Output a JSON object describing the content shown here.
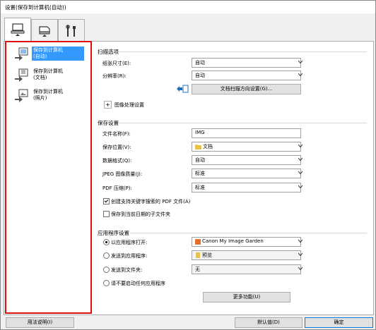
{
  "window": {
    "title": "设置(保存到计算机(自动))"
  },
  "tabs": [
    {
      "name": "scan-from-computer",
      "icon": "computer-scan-icon"
    },
    {
      "name": "scan-from-operation-panel",
      "icon": "scanner-icon"
    },
    {
      "name": "general-settings",
      "icon": "tools-icon"
    }
  ],
  "sidebar": {
    "items": [
      {
        "label1": "保存到计算机",
        "label2": "(自动)",
        "selected": true
      },
      {
        "label1": "保存到计算机",
        "label2": "(文档)",
        "selected": false
      },
      {
        "label1": "保存到计算机",
        "label2": "(照片)",
        "selected": false
      }
    ]
  },
  "scan_options": {
    "title": "扫描选项",
    "paper_size_label": "纸张尺寸(E):",
    "paper_size_value": "自动",
    "resolution_label": "分辨率(R):",
    "resolution_value": "自动",
    "orientation_button": "文档扫描方向设置(G)...",
    "image_processing_label": "图像处理设置"
  },
  "save_settings": {
    "title": "保存设置",
    "file_name_label": "文件名称(F):",
    "file_name_value": "IMG",
    "save_in_label": "保存位置(V):",
    "save_in_value": "文档",
    "data_format_label": "数据格式(Q):",
    "data_format_value": "自动",
    "jpeg_quality_label": "JPEG 图像质量(J):",
    "jpeg_quality_value": "标准",
    "pdf_compression_label": "PDF 压缩(P):",
    "pdf_compression_value": "标准",
    "keyword_pdf_label": "创建支持关键字搜索的 PDF 文件(A)",
    "keyword_pdf_checked": true,
    "subfolder_label": "保存到当前日期的子文件夹",
    "subfolder_checked": false
  },
  "app_settings": {
    "title": "应用程序设置",
    "open_with_label": "以应用程序打开:",
    "open_with_value": "Canon My Image Garden",
    "send_to_app_label": "发送到应用程序:",
    "send_to_app_value": "预览",
    "send_to_folder_label": "发送到文件夹:",
    "send_to_folder_value": "无",
    "do_not_start_label": "请不要启动任何应用程序",
    "selected": "open_with",
    "more_functions_button": "更多功能(U)"
  },
  "footer": {
    "help_button": "用法说明(I)",
    "defaults_button": "默认值(D)",
    "ok_button": "确定"
  },
  "colors": {
    "selection": "#3399ff",
    "highlight_border": "#e01010"
  }
}
